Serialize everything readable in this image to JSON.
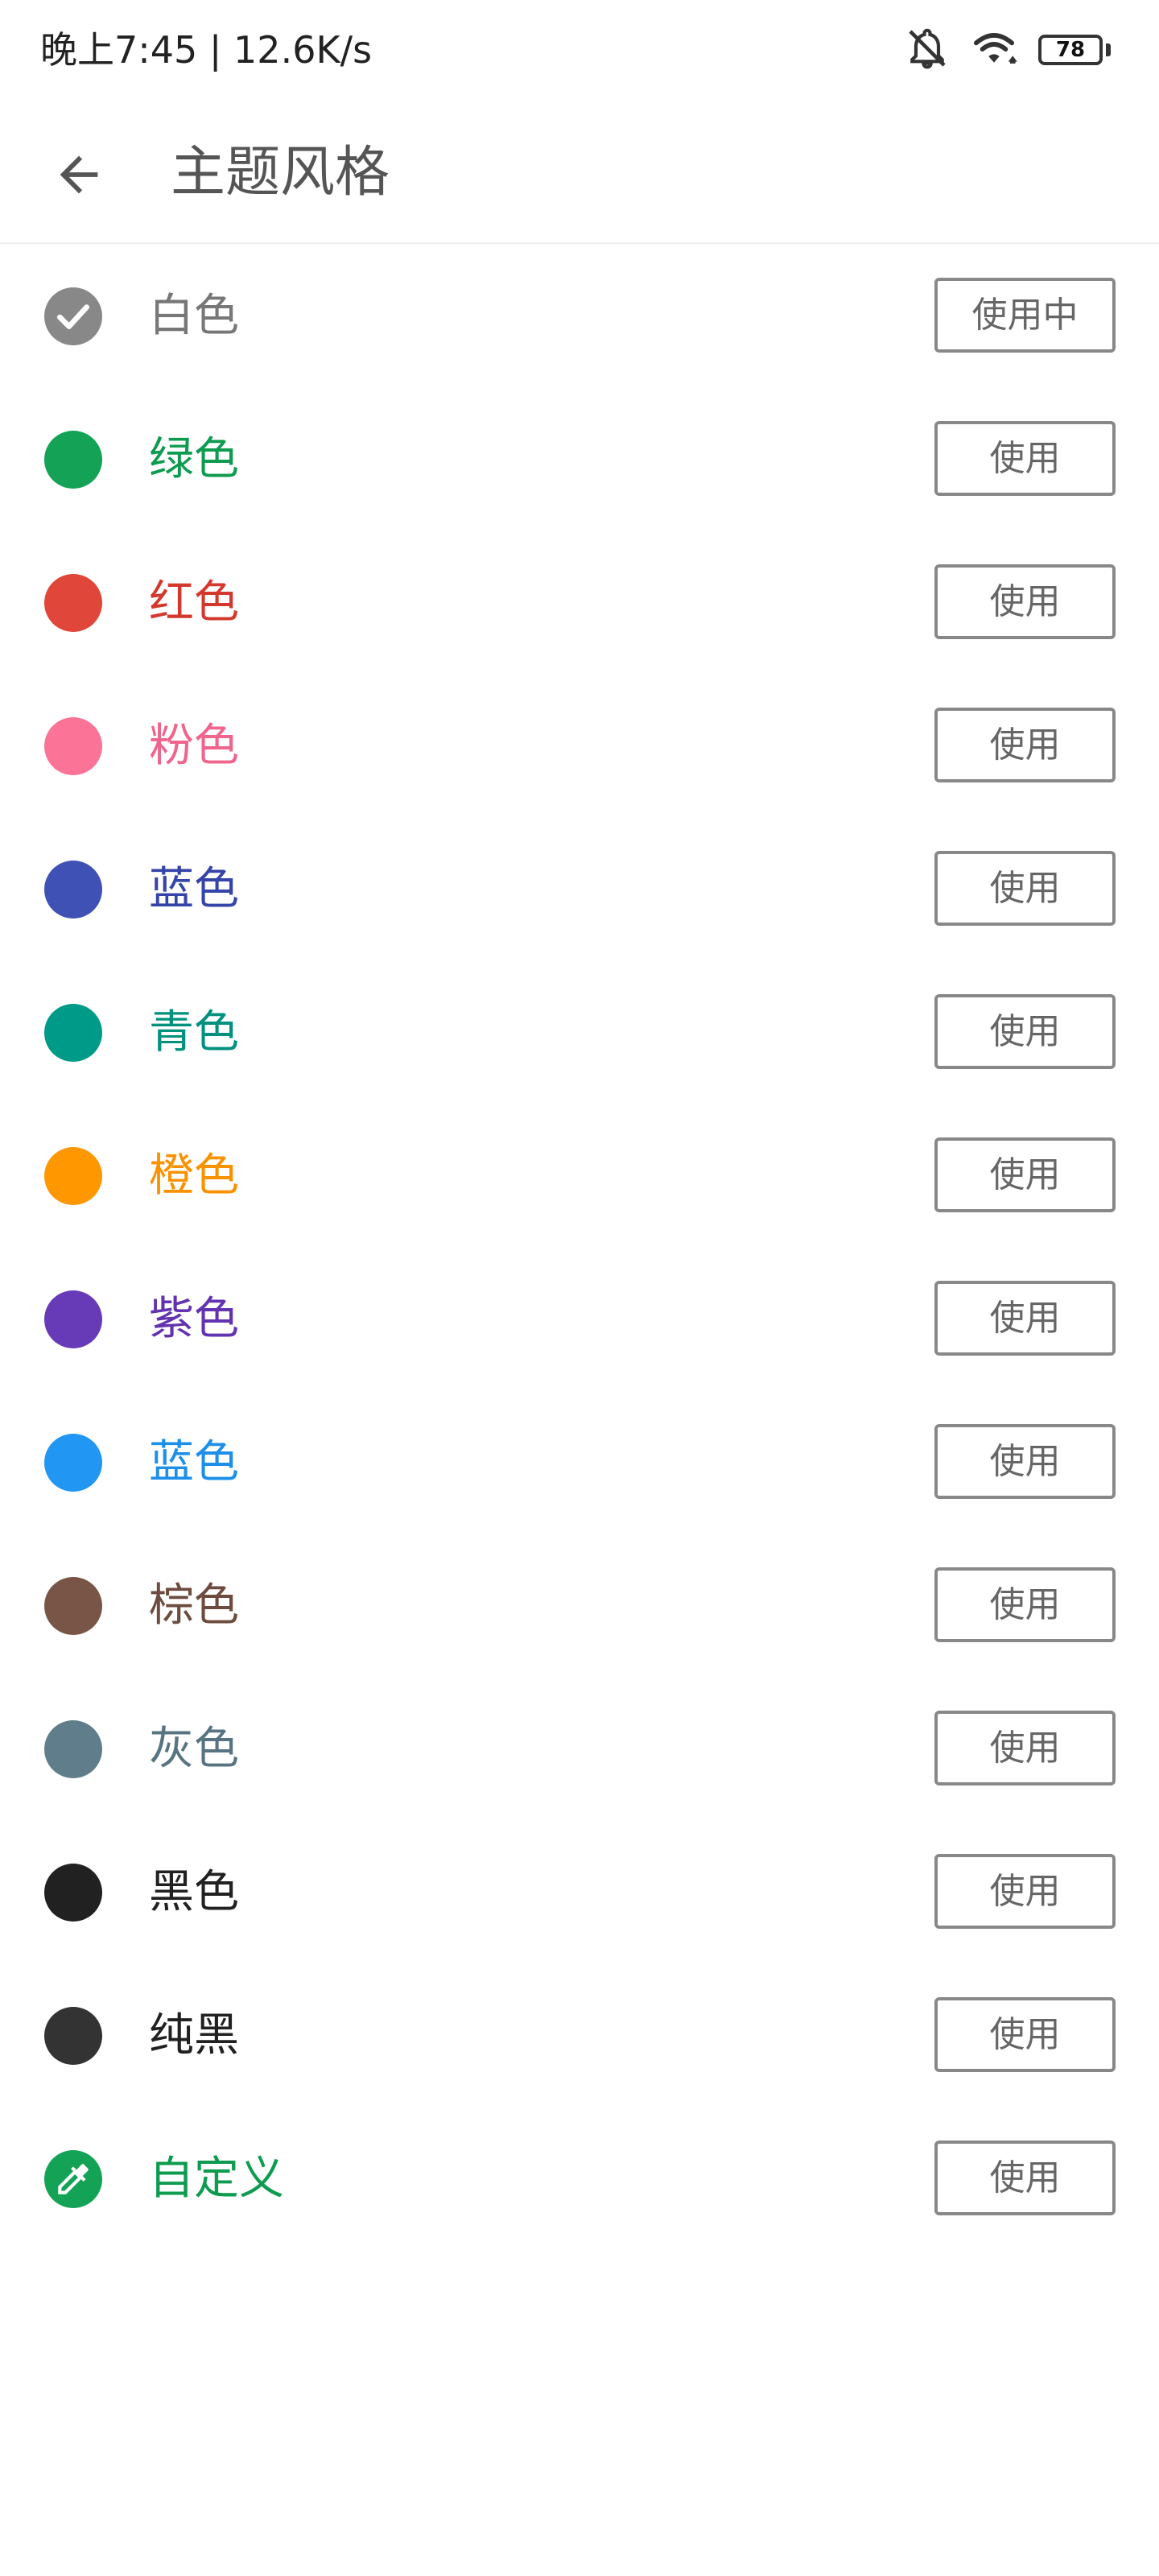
{
  "status_bar": {
    "time_speed": "晚上7:45 | 12.6K/s",
    "battery_level": "78",
    "battery_fraction": 0.78
  },
  "header": {
    "title": "主题风格",
    "back_icon": "arrow-back-icon"
  },
  "themes": [
    {
      "label": "白色",
      "color": "#888888",
      "label_color": "#777777",
      "button": "使用中",
      "selected": true,
      "icon": "check-icon"
    },
    {
      "label": "绿色",
      "color": "#14A356",
      "label_color": "#0E9B4F",
      "button": "使用"
    },
    {
      "label": "红色",
      "color": "#E0463A",
      "label_color": "#D4382C",
      "button": "使用"
    },
    {
      "label": "粉色",
      "color": "#FC7398",
      "label_color": "#F0658C",
      "button": "使用"
    },
    {
      "label": "蓝色",
      "color": "#3F51B5",
      "label_color": "#3544A8",
      "button": "使用"
    },
    {
      "label": "青色",
      "color": "#009A88",
      "label_color": "#00907E",
      "button": "使用"
    },
    {
      "label": "橙色",
      "color": "#FF9800",
      "label_color": "#FA9200",
      "button": "使用"
    },
    {
      "label": "紫色",
      "color": "#673AB7",
      "label_color": "#6232B0",
      "button": "使用"
    },
    {
      "label": "蓝色",
      "color": "#2196F3",
      "label_color": "#1E8FE8",
      "button": "使用"
    },
    {
      "label": "棕色",
      "color": "#795548",
      "label_color": "#6E4B3F",
      "button": "使用"
    },
    {
      "label": "灰色",
      "color": "#607D8B",
      "label_color": "#587482",
      "button": "使用"
    },
    {
      "label": "黑色",
      "color": "#212121",
      "label_color": "#212121",
      "button": "使用"
    },
    {
      "label": "纯黑",
      "color": "#333333",
      "label_color": "#212121",
      "button": "使用"
    },
    {
      "label": "自定义",
      "color": "#14A356",
      "label_color": "#0E9B4F",
      "button": "使用",
      "icon": "eyedropper-icon"
    }
  ]
}
